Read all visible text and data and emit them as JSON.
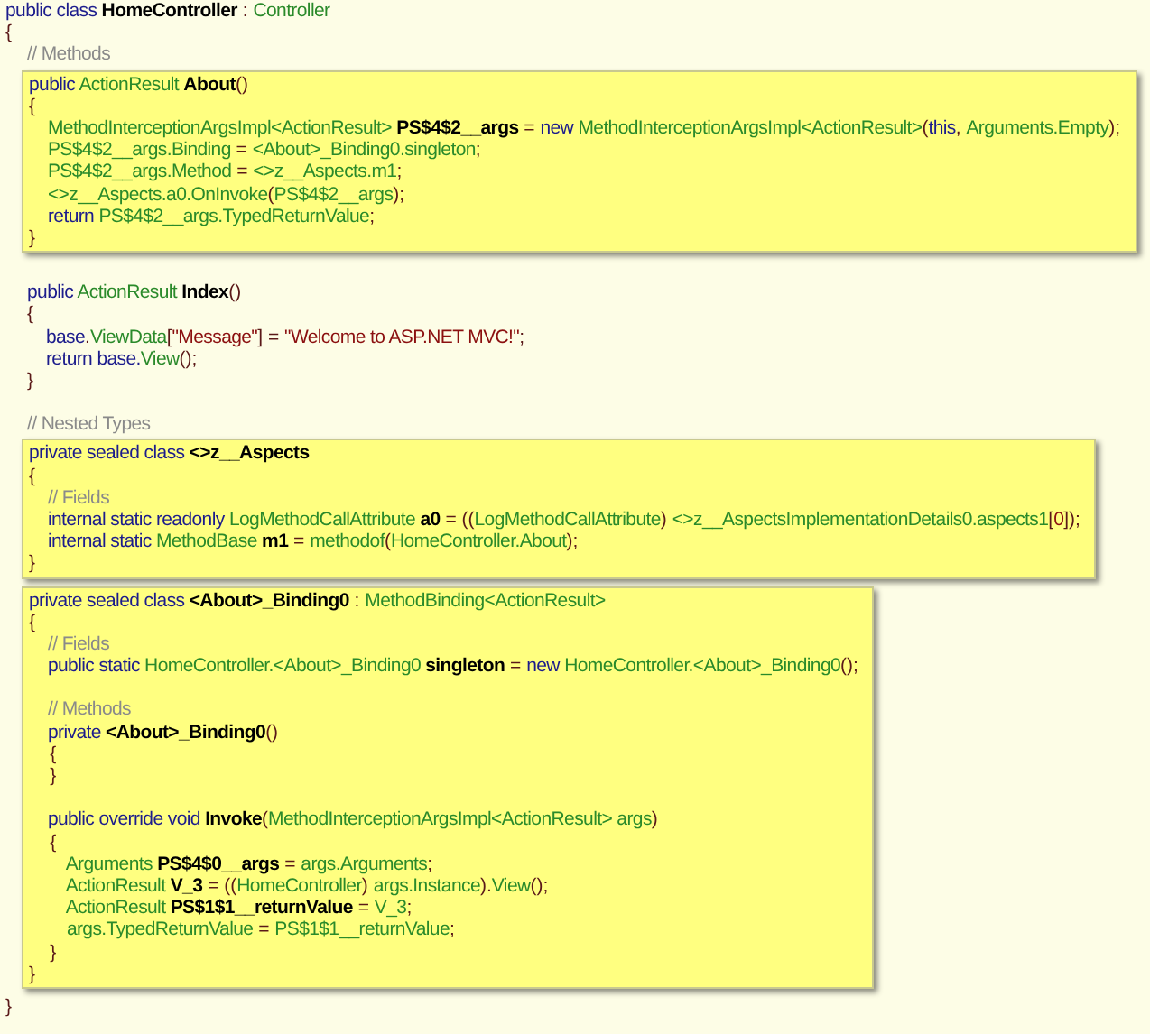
{
  "blocks": [
    {
      "kind": "outer",
      "lines": [
        {
          "tokens": [
            {
              "kind": "kw",
              "text": "public class "
            },
            {
              "kind": "bold",
              "text": "HomeController"
            },
            {
              "kind": "punct",
              "text": " : "
            },
            {
              "kind": "type",
              "text": "Controller"
            }
          ]
        },
        {
          "tokens": [
            {
              "kind": "punct",
              "text": "{"
            }
          ]
        }
      ]
    },
    {
      "kind": "plain",
      "lines": [
        {
          "tokens": [
            {
              "kind": "comment",
              "text": "// Methods"
            }
          ]
        }
      ]
    },
    {
      "kind": "highlight",
      "lines": [
        {
          "tokens": [
            {
              "kind": "kw",
              "text": "public "
            },
            {
              "kind": "type",
              "text": "ActionResult "
            },
            {
              "kind": "bold",
              "text": "About"
            },
            {
              "kind": "punct",
              "text": "()"
            }
          ]
        },
        {
          "tokens": [
            {
              "kind": "punct",
              "text": "{"
            }
          ]
        },
        {
          "tokens": [
            {
              "kind": "type",
              "text": "    MethodInterceptionArgsImpl<ActionResult> "
            },
            {
              "kind": "bold",
              "text": "PS$4$2__args"
            },
            {
              "kind": "punct",
              "text": " = "
            },
            {
              "kind": "kw",
              "text": "new "
            },
            {
              "kind": "type",
              "text": "MethodInterceptionArgsImpl<ActionResult>"
            },
            {
              "kind": "punct",
              "text": "("
            },
            {
              "kind": "kw",
              "text": "this"
            },
            {
              "kind": "punct",
              "text": ", "
            },
            {
              "kind": "type",
              "text": "Arguments.Empty"
            },
            {
              "kind": "punct",
              "text": ");"
            }
          ]
        },
        {
          "tokens": [
            {
              "kind": "type",
              "text": "    PS$4$2__args.Binding"
            },
            {
              "kind": "punct",
              "text": " = "
            },
            {
              "kind": "type",
              "text": "<About>_Binding0.singleton"
            },
            {
              "kind": "punct",
              "text": ";"
            }
          ]
        },
        {
          "tokens": [
            {
              "kind": "type",
              "text": "    PS$4$2__args.Method"
            },
            {
              "kind": "punct",
              "text": " = "
            },
            {
              "kind": "type",
              "text": "<>z__Aspects.m1"
            },
            {
              "kind": "punct",
              "text": ";"
            }
          ]
        },
        {
          "tokens": [
            {
              "kind": "type",
              "text": "    <>z__Aspects.a0.OnInvoke"
            },
            {
              "kind": "punct",
              "text": "("
            },
            {
              "kind": "type",
              "text": "PS$4$2__args"
            },
            {
              "kind": "punct",
              "text": ");"
            }
          ]
        },
        {
          "tokens": [
            {
              "kind": "kw",
              "text": "    return "
            },
            {
              "kind": "type",
              "text": "PS$4$2__args.TypedReturnValue"
            },
            {
              "kind": "punct",
              "text": ";"
            }
          ]
        },
        {
          "tokens": [
            {
              "kind": "punct",
              "text": "}"
            }
          ]
        }
      ]
    },
    {
      "kind": "plain",
      "lines": [
        {
          "kind": "blank"
        },
        {
          "tokens": [
            {
              "kind": "kw",
              "text": "public "
            },
            {
              "kind": "type",
              "text": "ActionResult "
            },
            {
              "kind": "bold",
              "text": "Index"
            },
            {
              "kind": "punct",
              "text": "()"
            }
          ]
        },
        {
          "tokens": [
            {
              "kind": "punct",
              "text": "{"
            }
          ]
        },
        {
          "tokens": [
            {
              "kind": "kw",
              "text": "    base"
            },
            {
              "kind": "punct",
              "text": "."
            },
            {
              "kind": "type",
              "text": "ViewData"
            },
            {
              "kind": "punct",
              "text": "["
            },
            {
              "kind": "string",
              "text": "\"Message\""
            },
            {
              "kind": "punct",
              "text": "] = "
            },
            {
              "kind": "string",
              "text": "\"Welcome to ASP.NET MVC!\""
            },
            {
              "kind": "punct",
              "text": ";"
            }
          ]
        },
        {
          "tokens": [
            {
              "kind": "kw",
              "text": "    return base."
            },
            {
              "kind": "type",
              "text": "View"
            },
            {
              "kind": "punct",
              "text": "();"
            }
          ]
        },
        {
          "tokens": [
            {
              "kind": "punct",
              "text": "}"
            }
          ]
        },
        {
          "kind": "blank"
        },
        {
          "tokens": [
            {
              "kind": "comment",
              "text": "// Nested Types"
            }
          ]
        }
      ]
    },
    {
      "kind": "highlight",
      "lines": [
        {
          "tokens": [
            {
              "kind": "kw",
              "text": "private sealed class "
            },
            {
              "kind": "bold",
              "text": "<>z__Aspects"
            }
          ]
        },
        {
          "tokens": [
            {
              "kind": "punct",
              "text": "{"
            }
          ]
        },
        {
          "tokens": [
            {
              "kind": "comment",
              "text": "    // Fields"
            }
          ]
        },
        {
          "tokens": [
            {
              "kind": "kw",
              "text": "    internal static readonly "
            },
            {
              "kind": "type",
              "text": "LogMethodCallAttribute "
            },
            {
              "kind": "bold",
              "text": "a0"
            },
            {
              "kind": "punct",
              "text": " = (("
            },
            {
              "kind": "type",
              "text": "LogMethodCallAttribute"
            },
            {
              "kind": "punct",
              "text": ") "
            },
            {
              "kind": "type",
              "text": "<>z__AspectsImplementationDetails0.aspects1"
            },
            {
              "kind": "punct",
              "text": "["
            },
            {
              "kind": "string",
              "text": "0"
            },
            {
              "kind": "punct",
              "text": "]);"
            }
          ]
        },
        {
          "tokens": [
            {
              "kind": "kw",
              "text": "    internal static "
            },
            {
              "kind": "type",
              "text": "MethodBase "
            },
            {
              "kind": "bold",
              "text": "m1"
            },
            {
              "kind": "punct",
              "text": " = "
            },
            {
              "kind": "type",
              "text": "methodof"
            },
            {
              "kind": "punct",
              "text": "("
            },
            {
              "kind": "type",
              "text": "HomeController.About"
            },
            {
              "kind": "punct",
              "text": ");"
            }
          ]
        },
        {
          "tokens": [
            {
              "kind": "punct",
              "text": "}"
            }
          ]
        }
      ]
    },
    {
      "kind": "highlight",
      "lines": [
        {
          "tokens": [
            {
              "kind": "kw",
              "text": "private sealed class "
            },
            {
              "kind": "bold",
              "text": "<About>_Binding0"
            },
            {
              "kind": "punct",
              "text": " : "
            },
            {
              "kind": "type",
              "text": "MethodBinding<ActionResult>"
            }
          ]
        },
        {
          "tokens": [
            {
              "kind": "punct",
              "text": "{"
            }
          ]
        },
        {
          "tokens": [
            {
              "kind": "comment",
              "text": "    // Fields"
            }
          ]
        },
        {
          "tokens": [
            {
              "kind": "kw",
              "text": "    public static "
            },
            {
              "kind": "type",
              "text": "HomeController.<About>_Binding0 "
            },
            {
              "kind": "bold",
              "text": "singleton"
            },
            {
              "kind": "punct",
              "text": " = "
            },
            {
              "kind": "kw",
              "text": "new "
            },
            {
              "kind": "type",
              "text": "HomeController.<About>_Binding0"
            },
            {
              "kind": "punct",
              "text": "();"
            }
          ]
        },
        {
          "kind": "blank"
        },
        {
          "tokens": [
            {
              "kind": "comment",
              "text": "    // Methods"
            }
          ]
        },
        {
          "tokens": [
            {
              "kind": "kw",
              "text": "    private "
            },
            {
              "kind": "bold",
              "text": "<About>_Binding0"
            },
            {
              "kind": "punct",
              "text": "()"
            }
          ]
        },
        {
          "tokens": [
            {
              "kind": "punct",
              "text": "    {"
            }
          ]
        },
        {
          "tokens": [
            {
              "kind": "punct",
              "text": "    }"
            }
          ]
        },
        {
          "kind": "blank"
        },
        {
          "tokens": [
            {
              "kind": "kw",
              "text": "    public override void "
            },
            {
              "kind": "bold",
              "text": "Invoke"
            },
            {
              "kind": "punct",
              "text": "("
            },
            {
              "kind": "type",
              "text": "MethodInterceptionArgsImpl<ActionResult> args"
            },
            {
              "kind": "punct",
              "text": ")"
            }
          ]
        },
        {
          "tokens": [
            {
              "kind": "punct",
              "text": "    {"
            }
          ]
        },
        {
          "tokens": [
            {
              "kind": "type",
              "text": "        Arguments "
            },
            {
              "kind": "bold",
              "text": "PS$4$0__args"
            },
            {
              "kind": "punct",
              "text": " = "
            },
            {
              "kind": "type",
              "text": "args.Arguments"
            },
            {
              "kind": "punct",
              "text": ";"
            }
          ]
        },
        {
          "tokens": [
            {
              "kind": "type",
              "text": "        ActionResult "
            },
            {
              "kind": "bold",
              "text": "V_3"
            },
            {
              "kind": "punct",
              "text": " = (("
            },
            {
              "kind": "type",
              "text": "HomeController"
            },
            {
              "kind": "punct",
              "text": ") "
            },
            {
              "kind": "type",
              "text": "args.Instance"
            },
            {
              "kind": "punct",
              "text": ")."
            },
            {
              "kind": "type",
              "text": "View"
            },
            {
              "kind": "punct",
              "text": "();"
            }
          ]
        },
        {
          "tokens": [
            {
              "kind": "type",
              "text": "        ActionResult "
            },
            {
              "kind": "bold",
              "text": "PS$1$1__returnValue"
            },
            {
              "kind": "punct",
              "text": " = "
            },
            {
              "kind": "type",
              "text": "V_3"
            },
            {
              "kind": "punct",
              "text": ";"
            }
          ]
        },
        {
          "tokens": [
            {
              "kind": "type",
              "text": "        args.TypedReturnValue"
            },
            {
              "kind": "punct",
              "text": " = "
            },
            {
              "kind": "type",
              "text": "PS$1$1__returnValue"
            },
            {
              "kind": "punct",
              "text": ";"
            }
          ]
        },
        {
          "tokens": [
            {
              "kind": "punct",
              "text": "    }"
            }
          ]
        },
        {
          "tokens": [
            {
              "kind": "punct",
              "text": "}"
            }
          ]
        }
      ]
    },
    {
      "kind": "outer",
      "lines": [
        {
          "tokens": [
            {
              "kind": "punct",
              "text": "}"
            }
          ]
        }
      ]
    }
  ]
}
